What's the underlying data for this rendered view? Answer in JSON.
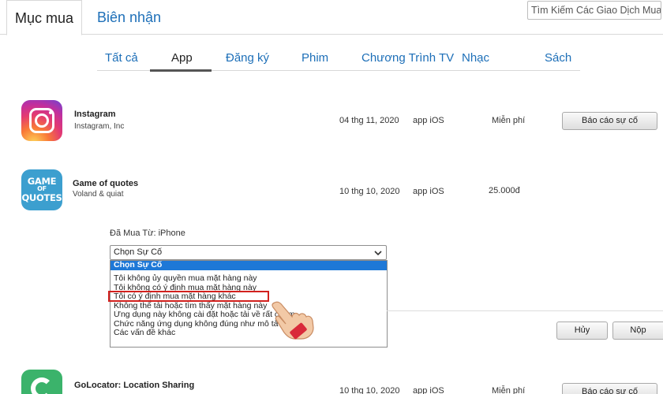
{
  "tabs": {
    "purchases": "Mục mua",
    "receipts": "Biên nhận"
  },
  "search": {
    "placeholder": "Tìm Kiếm Các Giao Dịch Mua"
  },
  "categories": [
    "Tất cả",
    "App",
    "Đăng ký",
    "Phim",
    "Chương Trình TV",
    "Nhạc",
    "Sách"
  ],
  "active_category": "App",
  "rows": [
    {
      "title": "Instagram",
      "developer": "Instagram, Inc",
      "date": "04 thg 11, 2020",
      "type": "app iOS",
      "price": "Miễn phí",
      "action": "Báo cáo sự cố"
    },
    {
      "title": "Game of quotes",
      "developer": "Voland & quiat",
      "date": "10 thg 10, 2020",
      "type": "app iOS",
      "price": "25.000đ"
    },
    {
      "title": "GoLocator: Location Sharing",
      "developer": "",
      "date": "10 thg 10, 2020",
      "type": "app iOS",
      "price": "Miễn phí",
      "action": "Báo cáo sự cố"
    }
  ],
  "icon_text": {
    "game_of_quotes": [
      "GAME",
      "OF",
      "QUOTES"
    ]
  },
  "report_form": {
    "purchased_from": "Đã Mua Từ: iPhone",
    "select_value": "Chọn Sự Cố",
    "options": [
      "Chọn Sự Cố",
      "Tôi không ủy quyền mua mặt hàng này",
      "Tôi không có ý định mua mặt hàng này",
      "Tôi có ý định mua mặt hàng khác",
      "Không thể tải hoặc tìm thấy mặt hàng này",
      "Ứng dụng này không cài đặt hoặc tải về rất chậm",
      "Chức năng ứng dụng không đúng như mô tả",
      "Các vấn đề khác"
    ],
    "highlighted_option_index": 3,
    "cancel": "Hủy",
    "submit": "Nộp"
  },
  "colors": {
    "link": "#1d6fb8",
    "selected": "#1e78d7",
    "highlight": "#d2211e"
  }
}
